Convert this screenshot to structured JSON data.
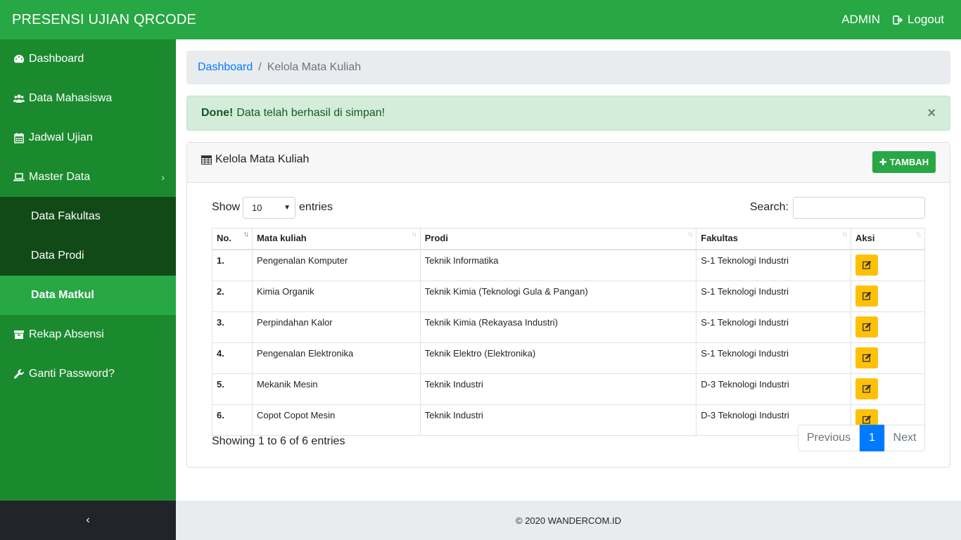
{
  "app": {
    "title": "PRESENSI UJIAN QRCODE",
    "user": "ADMIN",
    "logout_label": "Logout"
  },
  "sidebar": {
    "items": [
      {
        "label": "Dashboard",
        "icon": "dashboard-icon"
      },
      {
        "label": "Data Mahasiswa",
        "icon": "users-icon"
      },
      {
        "label": "Jadwal Ujian",
        "icon": "calendar-icon"
      },
      {
        "label": "Master Data",
        "icon": "laptop-icon",
        "chevron": "›"
      }
    ],
    "submenu": [
      {
        "label": "Data Fakultas"
      },
      {
        "label": "Data Prodi"
      },
      {
        "label": "Data Matkul",
        "active": true
      }
    ],
    "items_after": [
      {
        "label": "Rekap Absensi",
        "icon": "archive-icon"
      },
      {
        "label": "Ganti Password?",
        "icon": "wrench-icon"
      }
    ],
    "toggle": "‹"
  },
  "breadcrumb": {
    "link": "Dashboard",
    "separator": "/",
    "current": "Kelola Mata Kuliah"
  },
  "alert": {
    "strong": "Done!",
    "message": "Data telah berhasil di simpan!",
    "close": "×"
  },
  "card": {
    "title": "Kelola Mata Kuliah",
    "add_button": "TAMBAH"
  },
  "datatable": {
    "show_label": "Show",
    "entries_label": "entries",
    "page_length": "10",
    "search_label": "Search:",
    "search_value": "",
    "columns": [
      "No.",
      "Mata kuliah",
      "Prodi",
      "Fakultas",
      "Aksi"
    ],
    "rows": [
      [
        "1.",
        "Pengenalan Komputer",
        "Teknik Informatika",
        "S-1 Teknologi Industri"
      ],
      [
        "2.",
        "Kimia Organik",
        "Teknik Kimia (Teknologi Gula & Pangan)",
        "S-1 Teknologi Industri"
      ],
      [
        "3.",
        "Perpindahan Kalor",
        "Teknik Kimia (Rekayasa Industri)",
        "S-1 Teknologi Industri"
      ],
      [
        "4.",
        "Pengenalan Elektronika",
        "Teknik Elektro (Elektronika)",
        "S-1 Teknologi Industri"
      ],
      [
        "5.",
        "Mekanik Mesin",
        "Teknik Industri",
        "D-3 Teknologi Industri"
      ],
      [
        "6.",
        "Copot Copot Mesin",
        "Teknik Industri",
        "D-3 Teknologi Industri"
      ]
    ],
    "info": "Showing 1 to 6 of 6 entries",
    "pagination": {
      "previous": "Previous",
      "current": "1",
      "next": "Next"
    }
  },
  "footer": {
    "text": "© 2020 WANDERCOM.ID"
  },
  "colors": {
    "primary_green": "#28a745",
    "sidebar_green": "#1b8a2f",
    "submenu_dark": "#114a17",
    "edit_yellow": "#ffc107",
    "link_blue": "#007bff"
  }
}
